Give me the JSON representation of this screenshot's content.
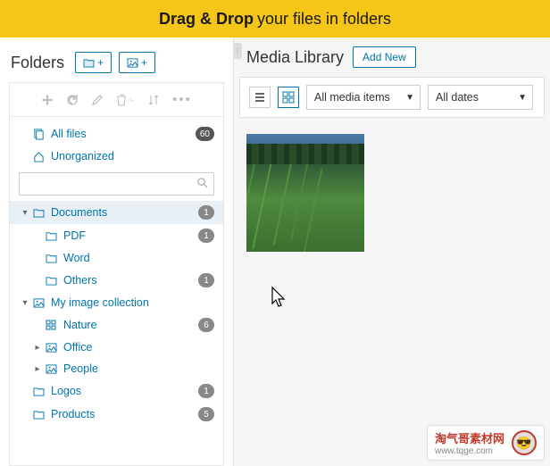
{
  "banner": {
    "bold": "Drag & Drop",
    "rest": " your files in folders"
  },
  "sidebar": {
    "title": "Folders",
    "newFolderBtn": "+",
    "newSubBtn": "+",
    "toolbar": {
      "move": "move",
      "reload": "reload",
      "edit": "edit",
      "delete": "delete",
      "sort": "sort",
      "more": "more"
    },
    "searchPlaceholder": "",
    "items": [
      {
        "label": "All files",
        "icon": "files",
        "count": "60",
        "depth": 0
      },
      {
        "label": "Unorganized",
        "icon": "home",
        "depth": 0
      },
      {
        "label": "Documents",
        "icon": "folder",
        "count": "1",
        "depth": 0,
        "arrow": "down",
        "selected": true
      },
      {
        "label": "PDF",
        "icon": "folder",
        "count": "1",
        "depth": 1
      },
      {
        "label": "Word",
        "icon": "folder",
        "depth": 1
      },
      {
        "label": "Others",
        "icon": "folder",
        "count": "1",
        "depth": 1
      },
      {
        "label": "My image collection",
        "icon": "gallery",
        "depth": 0,
        "arrow": "down"
      },
      {
        "label": "Nature",
        "icon": "grid",
        "count": "6",
        "depth": 1
      },
      {
        "label": "Office",
        "icon": "gallery",
        "depth": 1,
        "arrow": "right"
      },
      {
        "label": "People",
        "icon": "gallery",
        "depth": 1,
        "arrow": "right"
      },
      {
        "label": "Logos",
        "icon": "folder",
        "count": "1",
        "depth": 0
      },
      {
        "label": "Products",
        "icon": "folder",
        "count": "5",
        "depth": 0
      }
    ]
  },
  "content": {
    "title": "Media Library",
    "addNew": "Add New",
    "filterMedia": "All media items",
    "filterDate": "All dates"
  },
  "watermark": {
    "line1": "淘气哥素材网",
    "line2": "www.tqge.com"
  }
}
